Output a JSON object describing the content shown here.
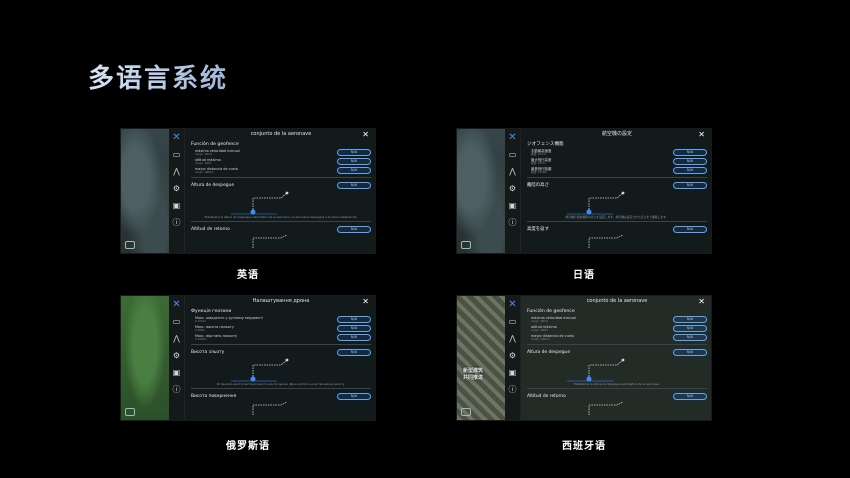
{
  "slide": {
    "title": "多语言系统"
  },
  "screens": [
    {
      "caption": "英语",
      "header": "conjunto de la aeronave",
      "section": "Función de geofence",
      "rows": [
        {
          "label": "máxima velocidad manual",
          "sub": "rango: 10m/s"
        },
        {
          "label": "altitud máxima",
          "sub": "rango: 100m"
        },
        {
          "label": "mayor distancia de vuelo",
          "sub": "rango: 1000m"
        }
      ],
      "value": "N/A",
      "takeoff_label": "Altura de despegue",
      "note": "Establezca la altura de despegue automático de la aeronave. La aeronave despegará a la altura establecida.",
      "return_label": "Altitud de retorno"
    },
    {
      "caption": "日语",
      "header": "航空機の設定",
      "section": "ジオフェンス機能",
      "rows": [
        {
          "label": "手動最高速度",
          "sub": "範囲: 10m/s"
        },
        {
          "label": "最大飛行高度",
          "sub": "範囲: 100m"
        },
        {
          "label": "最長飛行距離",
          "sub": "範囲: 1000m"
        }
      ],
      "value": "N/A",
      "takeoff_label": "離陸の高さ",
      "note": "航空機の自動離陸の高さを設定します。航空機は設定された高さまで離陸します。",
      "return_label": "高度を返す"
    },
    {
      "caption": "俄罗斯语",
      "header": "Налаштування дрона",
      "section": "Функція геозони",
      "rows": [
        {
          "label": "Макс. швидкість у ручному керуванні",
          "sub": "0-10m/s"
        },
        {
          "label": "Макс. висота польоту",
          "sub": "0-100m"
        },
        {
          "label": "Макс. відстань польоту",
          "sub": "0-1000m"
        }
      ],
      "value": "N/A",
      "takeoff_label": "Висота зльоту",
      "note": "Встановіть висоту автоматичного зльоту дрона. Дрон злетить на встановлену висоту.",
      "return_label": "Висота повернення"
    },
    {
      "caption": "西班牙语",
      "header": "conjunto de la aeronave",
      "section": "Función de geofence",
      "rows": [
        {
          "label": "máxima velocidad manual",
          "sub": "rango: 10m/s"
        },
        {
          "label": "altitud máxima",
          "sub": "rango: 100m"
        },
        {
          "label": "mayor distancia de vuelo",
          "sub": "rango: 1000m"
        }
      ],
      "value": "N/A",
      "takeoff_label": "Altura de despegue",
      "note": "Establezca la altura de despegue automático de la aeronave.",
      "return_label": "Altitud de retorno",
      "map_overlay": [
        "新型建筑",
        "共同推进"
      ]
    }
  ],
  "icons": {
    "drone": "drone-icon",
    "battery": "battery-icon",
    "flight": "flight-icon",
    "settings": "settings-icon",
    "camera": "camera-icon",
    "info": "info-icon",
    "close": "close-icon"
  },
  "colors": {
    "accent": "#5aa6ff",
    "background": "#000000"
  }
}
